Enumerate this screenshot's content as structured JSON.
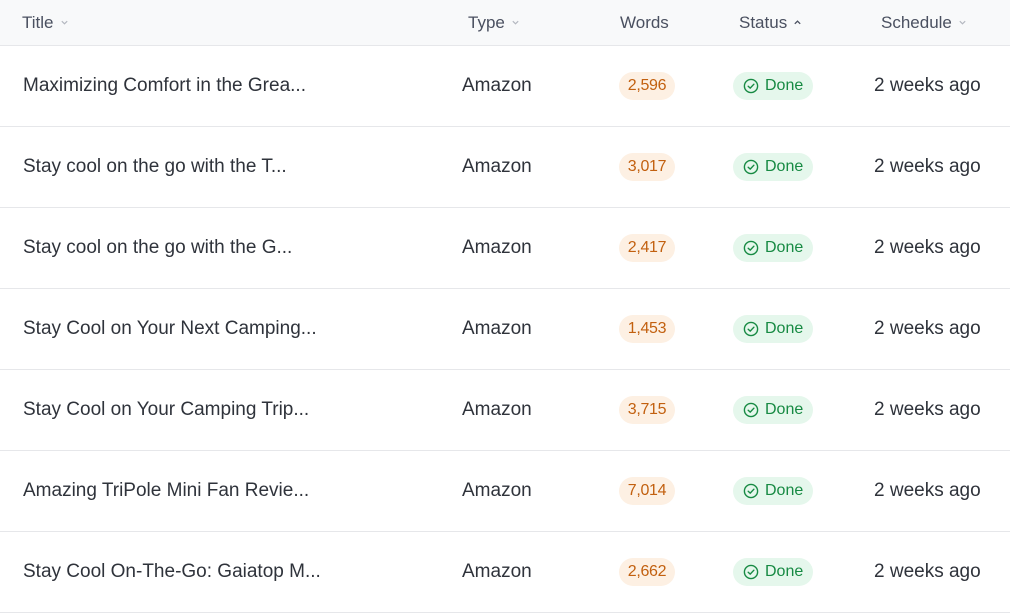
{
  "header": {
    "title_label": "Title",
    "type_label": "Type",
    "words_label": "Words",
    "status_label": "Status",
    "schedule_label": "Schedule"
  },
  "rows": [
    {
      "title": "Maximizing Comfort in the Grea...",
      "type": "Amazon",
      "words": "2,596",
      "status": "Done",
      "schedule": "2 weeks ago"
    },
    {
      "title": "Stay cool on the go with the T...",
      "type": "Amazon",
      "words": "3,017",
      "status": "Done",
      "schedule": "2 weeks ago"
    },
    {
      "title": "Stay cool on the go with the G...",
      "type": "Amazon",
      "words": "2,417",
      "status": "Done",
      "schedule": "2 weeks ago"
    },
    {
      "title": "Stay Cool on Your Next Camping...",
      "type": "Amazon",
      "words": "1,453",
      "status": "Done",
      "schedule": "2 weeks ago"
    },
    {
      "title": "Stay Cool on Your Camping Trip...",
      "type": "Amazon",
      "words": "3,715",
      "status": "Done",
      "schedule": "2 weeks ago"
    },
    {
      "title": "Amazing TriPole Mini Fan Revie...",
      "type": "Amazon",
      "words": "7,014",
      "status": "Done",
      "schedule": "2 weeks ago"
    },
    {
      "title": "Stay Cool On-The-Go: Gaiatop M...",
      "type": "Amazon",
      "words": "2,662",
      "status": "Done",
      "schedule": "2 weeks ago"
    }
  ],
  "colors": {
    "words_badge_bg": "#fdf0e3",
    "words_badge_text": "#c2600f",
    "status_badge_bg": "#e5f7ec",
    "status_badge_text": "#178a43"
  },
  "icons": {
    "sort_inactive": "chevron-down-icon",
    "sort_active": "chevron-up-icon",
    "status_done": "check-circle-icon"
  }
}
